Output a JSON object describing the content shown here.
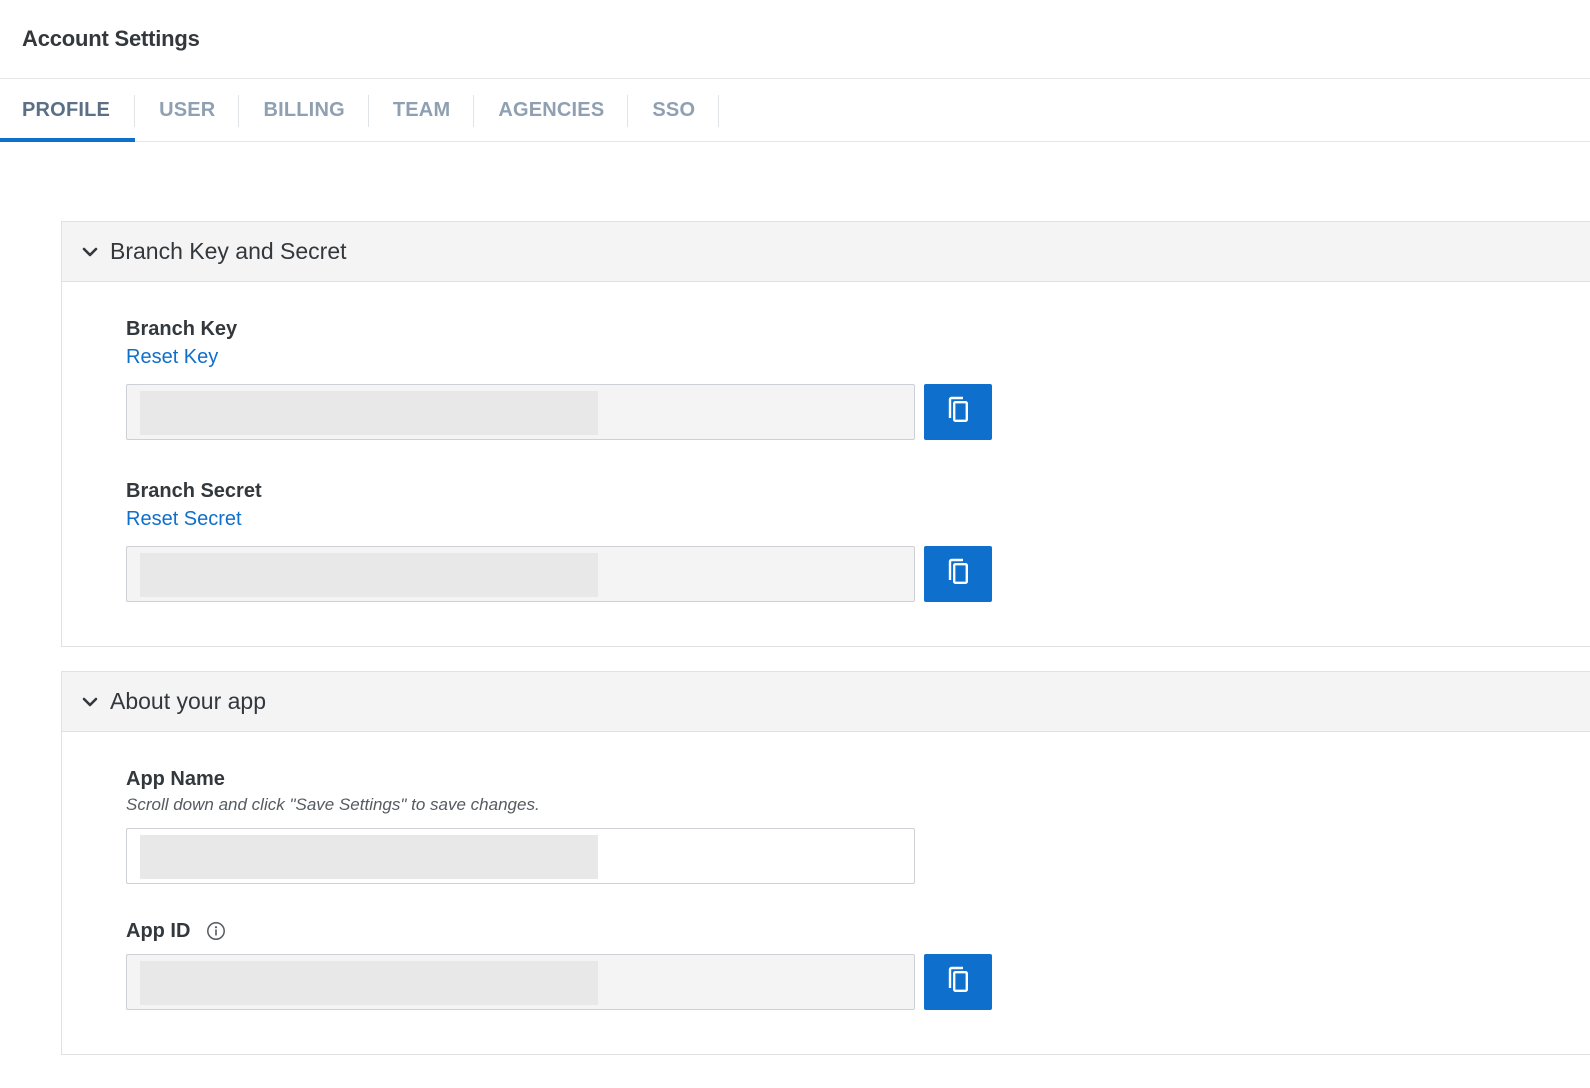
{
  "header": {
    "title": "Account Settings"
  },
  "tabs": [
    {
      "label": "PROFILE",
      "active": true
    },
    {
      "label": "USER",
      "active": false
    },
    {
      "label": "BILLING",
      "active": false
    },
    {
      "label": "TEAM",
      "active": false
    },
    {
      "label": "AGENCIES",
      "active": false
    },
    {
      "label": "SSO",
      "active": false
    }
  ],
  "sections": {
    "keys": {
      "title": "Branch Key and Secret",
      "branch_key": {
        "label": "Branch Key",
        "link": "Reset Key",
        "value": ""
      },
      "branch_secret": {
        "label": "Branch Secret",
        "link": "Reset Secret",
        "value": ""
      }
    },
    "about": {
      "title": "About your app",
      "app_name": {
        "label": "App Name",
        "hint": "Scroll down and click \"Save Settings\" to save changes.",
        "value": ""
      },
      "app_id": {
        "label": "App ID",
        "value": ""
      }
    }
  },
  "colors": {
    "accent": "#0f6fcc",
    "tab_inactive": "#8fa0b2",
    "tab_active": "#5b7086"
  },
  "icons": {
    "collapse": "chevron-down-icon",
    "copy": "copy-icon",
    "info": "info-icon"
  }
}
